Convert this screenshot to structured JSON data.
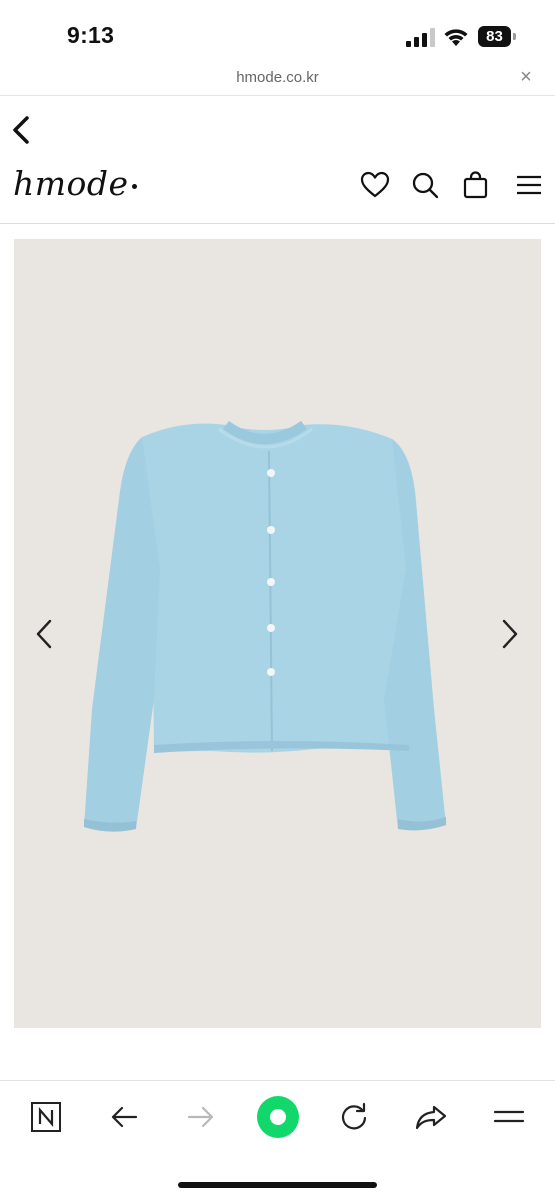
{
  "status": {
    "time": "9:13",
    "battery": "83"
  },
  "browser": {
    "url": "hmode.co.kr",
    "close_icon": "close-icon"
  },
  "site": {
    "brand": "hmode",
    "icons": [
      "back-chevron-icon",
      "heart-icon",
      "search-icon",
      "shopping-bag-icon",
      "hamburger-menu-icon"
    ]
  },
  "gallery": {
    "background": "#e9e5e1",
    "garment_color": "#a9d4e6",
    "prev_icon": "chevron-left-icon",
    "next_icon": "chevron-right-icon"
  },
  "toolbar": {
    "accent": "#12d86c",
    "icons": [
      "naver-n-icon",
      "arrow-left-icon",
      "arrow-right-icon",
      "green-dot-icon",
      "reload-icon",
      "share-icon",
      "menu-icon"
    ]
  }
}
